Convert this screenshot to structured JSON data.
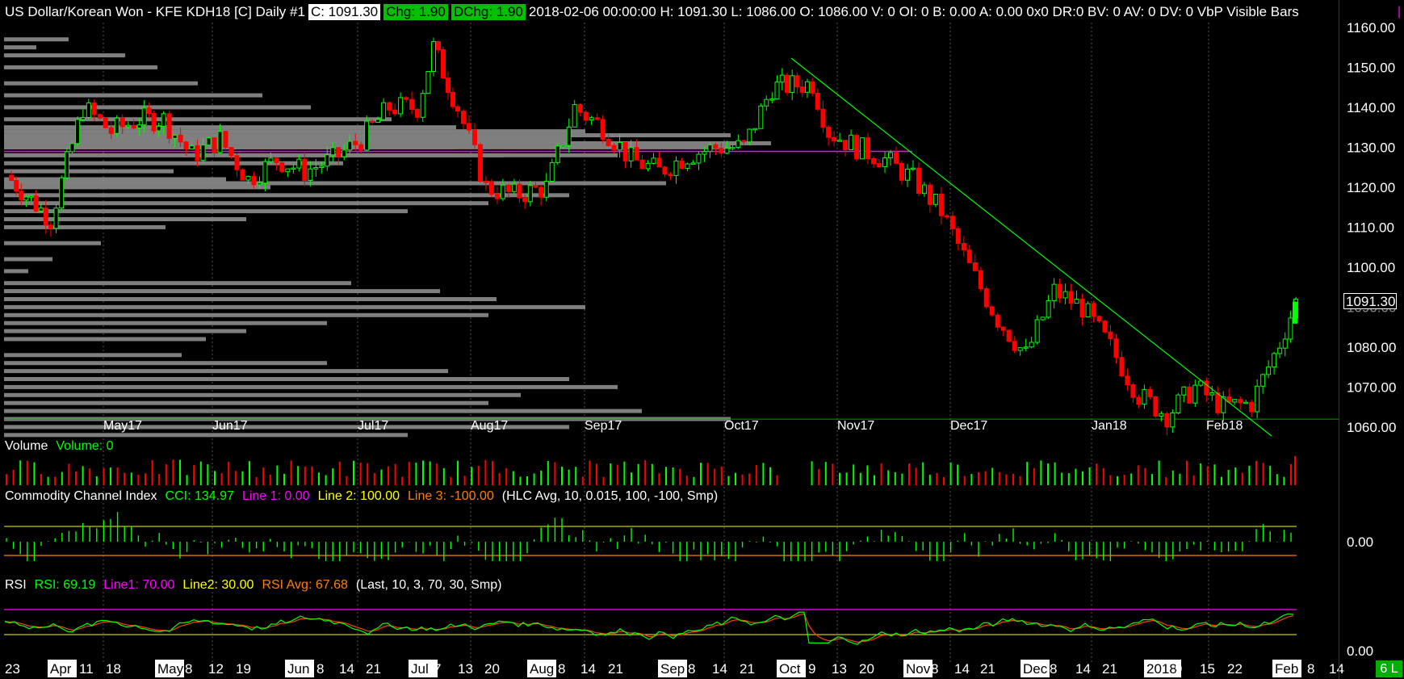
{
  "header": {
    "symbol": "US Dollar/Korean Won - KFE KDH18 [C]  Daily  #1",
    "close": "C: 1091.30",
    "chg": "Chg: 1.90",
    "dchg": "DChg: 1.90",
    "details": "2018-02-06 00:00:00 H: 1091.30 L: 1086.00 O: 1086.00 V: 0 OI: 0 B: 0.00 A: 0.00 0x0 DR:0 BV: 0 AV: 0 DV: 0 VbP Visible Bars"
  },
  "price_axis": {
    "ticks": [
      "1160.00",
      "1150.00",
      "1140.00",
      "1130.00",
      "1120.00",
      "1110.00",
      "1100.00",
      "1090.00",
      "1080.00",
      "1070.00",
      "1060.00"
    ],
    "last_price": "1091.30"
  },
  "volume_pane": {
    "title": "Volume",
    "value": "Volume: 0"
  },
  "cci_pane": {
    "title": "Commodity Channel Index",
    "cci": "CCI: 134.97",
    "line1": "Line 1: 0.00",
    "line2": "Line 2: 100.00",
    "line3": "Line 3: -100.00",
    "params": "(HLC Avg, 10, 0.015, 100, -100, Smp)",
    "axis_tick": "0.00"
  },
  "rsi_pane": {
    "title": "RSI",
    "rsi": "RSI: 69.19",
    "line1": "Line1: 70.00",
    "line2": "Line2: 30.00",
    "avg": "RSI Avg: 67.68",
    "params": "(Last, 10, 3, 70, 30, Smp)",
    "axis_tick": "0.00"
  },
  "main_month_labels": [
    "May17",
    "Jun17",
    "Jul17",
    "Aug17",
    "Sep17",
    "Oct17",
    "Nov17",
    "Dec17",
    "Jan18",
    "Feb18"
  ],
  "date_axis": [
    "23",
    "Apr",
    "11",
    "18",
    "May",
    "8",
    "12",
    "19",
    "Jun",
    "8",
    "14",
    "21",
    "Jul",
    "7",
    "13",
    "20",
    "Aug",
    "8",
    "14",
    "21",
    "Sep",
    "8",
    "14",
    "21",
    "Oct",
    "9",
    "13",
    "20",
    "Nov",
    "8",
    "14",
    "21",
    "Dec",
    "8",
    "14",
    "21",
    "2018",
    "9",
    "15",
    "22",
    "Feb",
    "8",
    "14"
  ],
  "badge": "6 L",
  "colors": {
    "up": "#00ff00",
    "down": "#ff0000",
    "profile": "#7f7f7f",
    "poc": "#ff00ff",
    "trendline": "#00ff00",
    "cci_upper": "#c8c800",
    "cci_lower": "#ff8000",
    "rsi_line": "#00ff00",
    "rsi_avg": "#ff4000"
  },
  "chart_data": {
    "type": "candlestick",
    "symbol": "US Dollar/Korean Won - KFE KDH18 [C]",
    "interval": "Daily",
    "y_range": [
      1057,
      1162
    ],
    "last": {
      "open": 1086.0,
      "high": 1091.3,
      "low": 1086.0,
      "close": 1091.3
    },
    "poc_level": 1129.0,
    "support_level": 1062.0,
    "trendline": {
      "from": {
        "date": "2017-10-02",
        "price": 1152.0
      },
      "to": {
        "date": "2018-02-06",
        "price": 1058.0
      }
    },
    "price_path": [
      {
        "date": "2017-03-23",
        "close": 1123
      },
      {
        "date": "2017-04-03",
        "close": 1112
      },
      {
        "date": "2017-04-11",
        "close": 1140
      },
      {
        "date": "2017-04-18",
        "close": 1134
      },
      {
        "date": "2017-04-25",
        "close": 1137
      },
      {
        "date": "2017-05-01",
        "close": 1137
      },
      {
        "date": "2017-05-08",
        "close": 1128
      },
      {
        "date": "2017-05-15",
        "close": 1132
      },
      {
        "date": "2017-05-22",
        "close": 1122
      },
      {
        "date": "2017-05-29",
        "close": 1127
      },
      {
        "date": "2017-06-05",
        "close": 1124
      },
      {
        "date": "2017-06-12",
        "close": 1127
      },
      {
        "date": "2017-06-19",
        "close": 1132
      },
      {
        "date": "2017-06-26",
        "close": 1140
      },
      {
        "date": "2017-07-03",
        "close": 1140
      },
      {
        "date": "2017-07-07",
        "close": 1155
      },
      {
        "date": "2017-07-13",
        "close": 1140
      },
      {
        "date": "2017-07-20",
        "close": 1120
      },
      {
        "date": "2017-07-27",
        "close": 1118
      },
      {
        "date": "2017-08-04",
        "close": 1120
      },
      {
        "date": "2017-08-11",
        "close": 1140
      },
      {
        "date": "2017-08-18",
        "close": 1135
      },
      {
        "date": "2017-08-25",
        "close": 1127
      },
      {
        "date": "2017-09-01",
        "close": 1124
      },
      {
        "date": "2017-09-08",
        "close": 1128
      },
      {
        "date": "2017-09-15",
        "close": 1130
      },
      {
        "date": "2017-09-22",
        "close": 1130
      },
      {
        "date": "2017-09-29",
        "close": 1145
      },
      {
        "date": "2017-10-09",
        "close": 1146
      },
      {
        "date": "2017-10-13",
        "close": 1134
      },
      {
        "date": "2017-10-20",
        "close": 1130
      },
      {
        "date": "2017-10-27",
        "close": 1127
      },
      {
        "date": "2017-11-03",
        "close": 1122
      },
      {
        "date": "2017-11-10",
        "close": 1114
      },
      {
        "date": "2017-11-17",
        "close": 1100
      },
      {
        "date": "2017-11-24",
        "close": 1087
      },
      {
        "date": "2017-12-01",
        "close": 1078
      },
      {
        "date": "2017-12-08",
        "close": 1094
      },
      {
        "date": "2017-12-15",
        "close": 1090
      },
      {
        "date": "2017-12-22",
        "close": 1080
      },
      {
        "date": "2017-12-29",
        "close": 1068
      },
      {
        "date": "2018-01-05",
        "close": 1063
      },
      {
        "date": "2018-01-12",
        "close": 1070
      },
      {
        "date": "2018-01-19",
        "close": 1065
      },
      {
        "date": "2018-01-26",
        "close": 1066
      },
      {
        "date": "2018-02-02",
        "close": 1081
      },
      {
        "date": "2018-02-06",
        "close": 1091.3
      }
    ],
    "volume_value": 0,
    "cci": {
      "value": 134.97,
      "lines": [
        0,
        100,
        -100
      ]
    },
    "rsi": {
      "value": 69.19,
      "avg": 67.68,
      "lines": [
        70,
        30
      ]
    }
  }
}
